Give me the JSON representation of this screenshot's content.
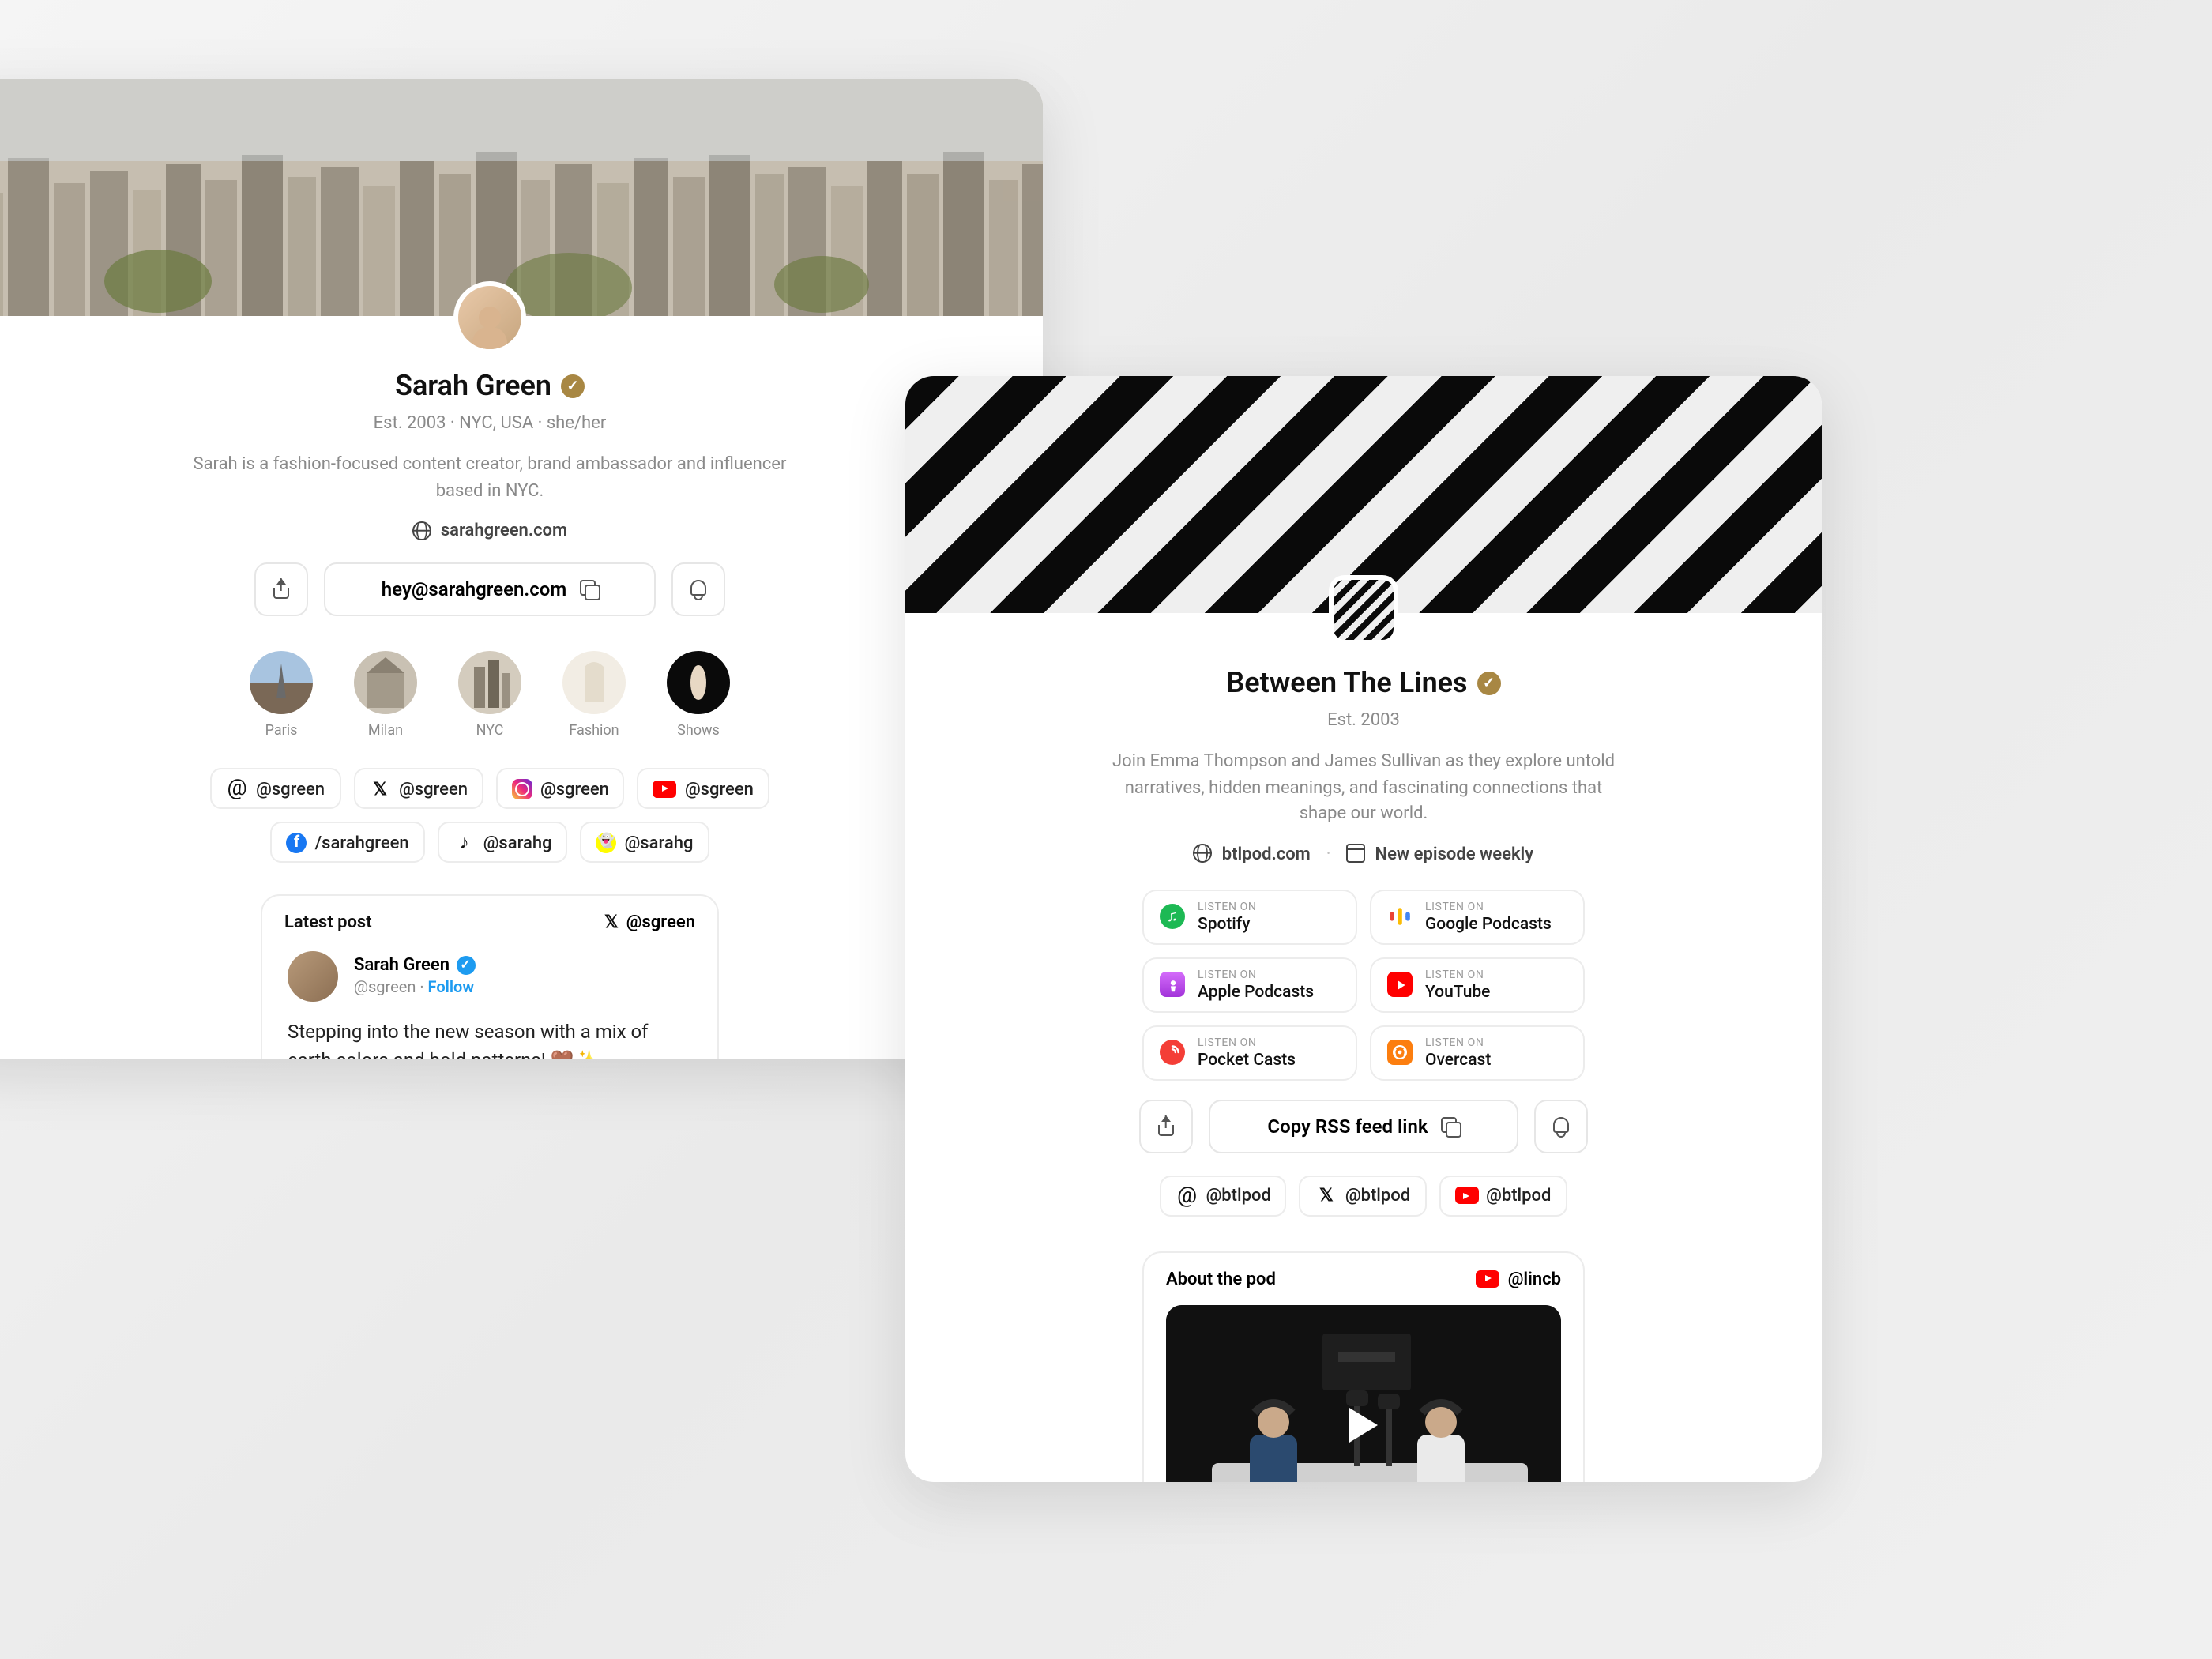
{
  "left": {
    "name": "Sarah Green",
    "meta": "Est. 2003  ·  NYC, USA  ·  she/her",
    "bio": "Sarah is a fashion-focused content creator, brand ambassador and influencer based in NYC.",
    "website": "sarahgreen.com",
    "email": "hey@sarahgreen.com",
    "stories": [
      {
        "label": "Paris"
      },
      {
        "label": "Milan"
      },
      {
        "label": "NYC"
      },
      {
        "label": "Fashion"
      },
      {
        "label": "Shows"
      }
    ],
    "socials": [
      {
        "platform": "threads",
        "handle": "@sgreen"
      },
      {
        "platform": "x",
        "handle": "@sgreen"
      },
      {
        "platform": "instagram",
        "handle": "@sgreen"
      },
      {
        "platform": "youtube",
        "handle": "@sgreen"
      },
      {
        "platform": "facebook",
        "handle": "/sarahgreen"
      },
      {
        "platform": "tiktok",
        "handle": "@sarahg"
      },
      {
        "platform": "snapchat",
        "handle": "@sarahg"
      }
    ],
    "post": {
      "section_title": "Latest post",
      "tag_handle": "@sgreen",
      "author": "Sarah Green",
      "handle": "@sgreen",
      "follow": "Follow",
      "text": "Stepping into the new season with a mix of earth colors and bold patterns! 🤎✨"
    }
  },
  "right": {
    "name": "Between The Lines",
    "meta": "Est. 2003",
    "bio": "Join Emma Thompson and James Sullivan as they explore untold narratives, hidden meanings, and fascinating connections that shape our world.",
    "website": "btlpod.com",
    "episode_note": "New episode weekly",
    "listen_label": "LISTEN ON",
    "listen": [
      {
        "name": "Spotify",
        "bg": "#1db954"
      },
      {
        "name": "Google Podcasts",
        "bg": "#ffffff"
      },
      {
        "name": "Apple Podcasts",
        "bg": "#b150e2"
      },
      {
        "name": "YouTube",
        "bg": "#ff0000"
      },
      {
        "name": "Pocket Casts",
        "bg": "#f43e37"
      },
      {
        "name": "Overcast",
        "bg": "#fc7e0f"
      }
    ],
    "rss_label": "Copy RSS feed link",
    "socials": [
      {
        "platform": "threads",
        "handle": "@btlpod"
      },
      {
        "platform": "x",
        "handle": "@btlpod"
      },
      {
        "platform": "youtube",
        "handle": "@btlpod"
      }
    ],
    "about": {
      "title": "About the pod",
      "tag_handle": "@lincb"
    }
  }
}
